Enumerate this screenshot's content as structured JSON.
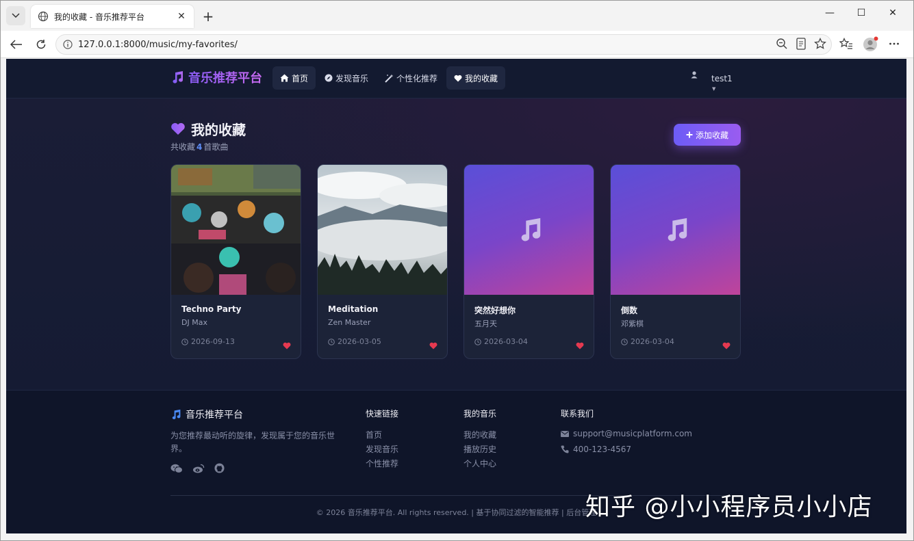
{
  "browser": {
    "tab_title": "我的收藏 - 音乐推荐平台",
    "url": "127.0.0.1:8000/music/my-favorites/",
    "tab_close": "✕",
    "new_tab": "+",
    "minimize": "—",
    "maximize": "☐",
    "close": "✕"
  },
  "header": {
    "brand": "音乐推荐平台",
    "menu": [
      {
        "label": "首页",
        "icon": "home-icon"
      },
      {
        "label": "发现音乐",
        "icon": "compass-icon"
      },
      {
        "label": "个性化推荐",
        "icon": "magic-icon"
      },
      {
        "label": "我的收藏",
        "icon": "heart-icon"
      }
    ],
    "username": "test1"
  },
  "main": {
    "title": "我的收藏",
    "subtitle_prefix": "共收藏",
    "count": "4",
    "subtitle_suffix": "首歌曲",
    "add_button": "添加收藏",
    "cards": [
      {
        "title": "Techno Party",
        "artist": "DJ Max",
        "date": "2026-09-13"
      },
      {
        "title": "Meditation",
        "artist": "Zen Master",
        "date": "2026-03-05"
      },
      {
        "title": "突然好想你",
        "artist": "五月天",
        "date": "2026-03-04"
      },
      {
        "title": "倒数",
        "artist": "邓紫棋",
        "date": "2026-03-04"
      }
    ]
  },
  "footer": {
    "brand": "音乐推荐平台",
    "desc": "为您推荐最动听的旋律，发现属于您的音乐世界。",
    "quick_links_title": "快速链接",
    "quick_links": [
      "首页",
      "发现音乐",
      "个性推荐"
    ],
    "my_music_title": "我的音乐",
    "my_music": [
      "我的收藏",
      "播放历史",
      "个人中心"
    ],
    "contact_title": "联系我们",
    "email": "support@musicplatform.com",
    "phone": "400-123-4567",
    "copyright": "© 2026 音乐推荐平台. All rights reserved. | 基于协同过滤的智能推荐 | 后台管理"
  },
  "watermark": "知乎 @小小程序员小小店",
  "colors": {
    "accent": "#8a5cf6",
    "heart": "#e53950",
    "background": "#111830"
  }
}
